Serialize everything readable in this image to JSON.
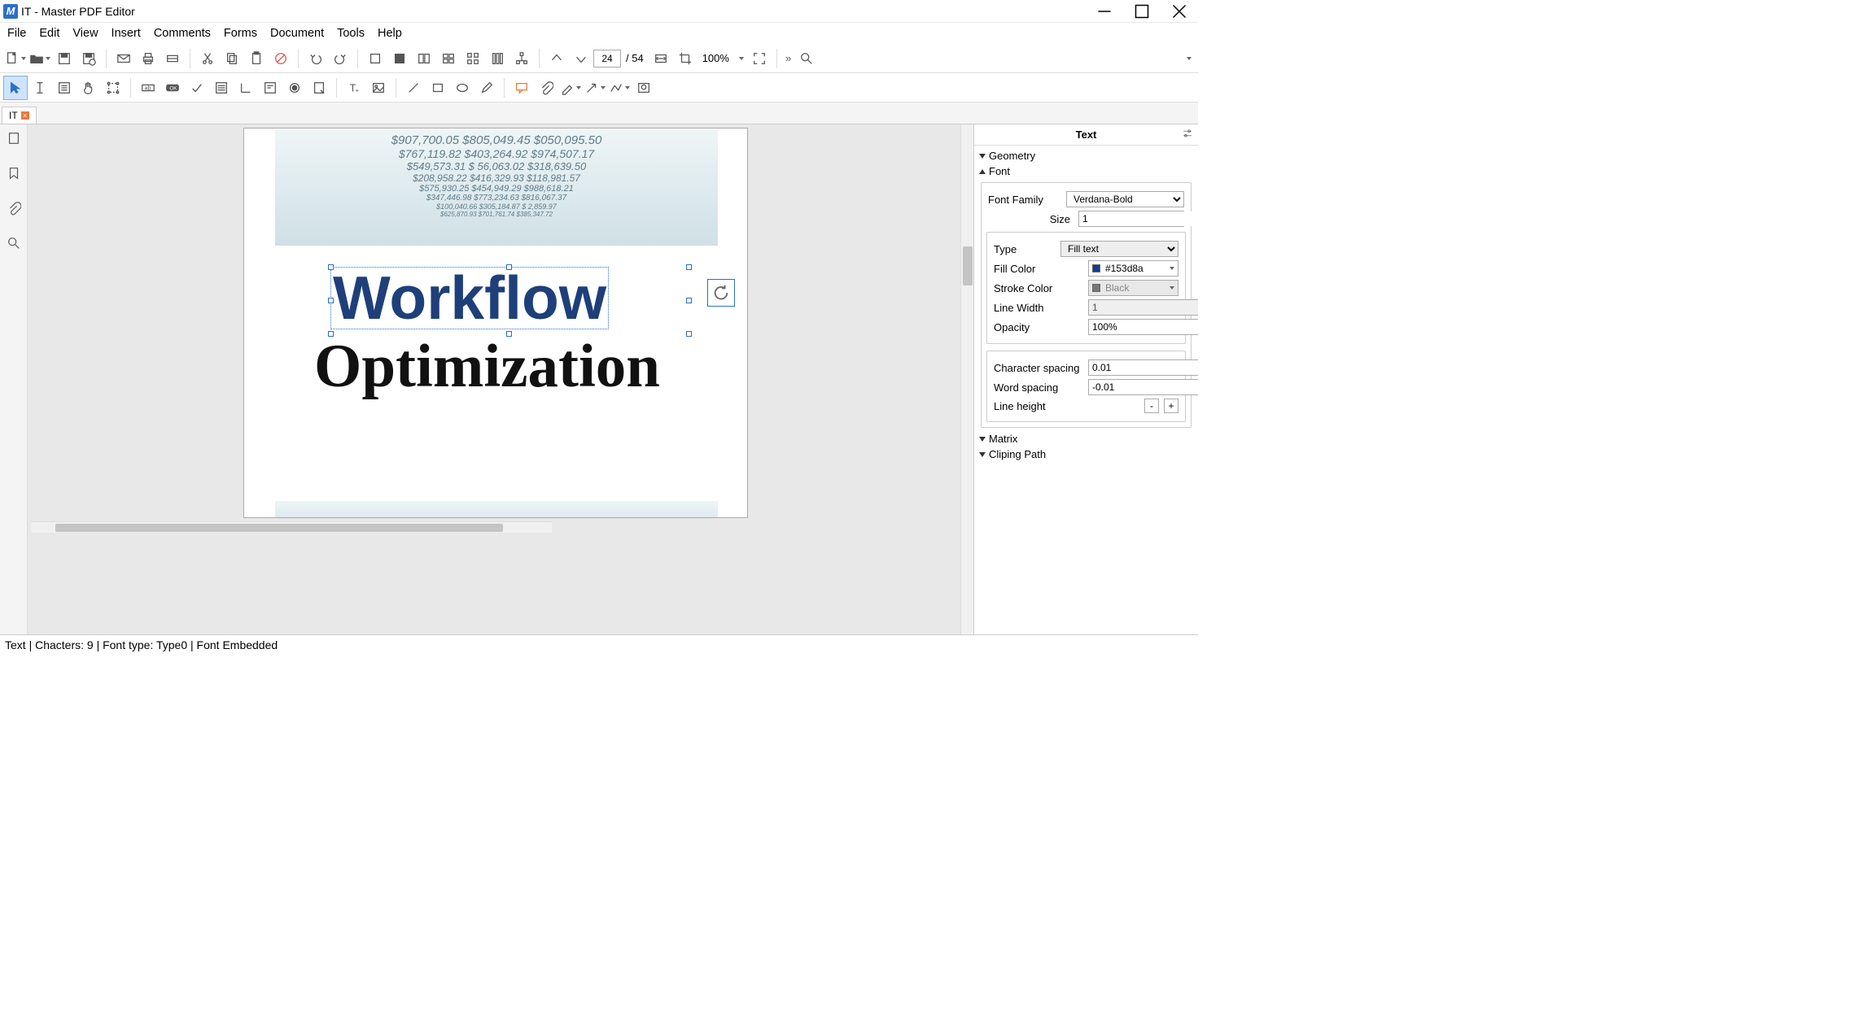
{
  "title": "IT - Master PDF Editor",
  "menu": [
    "File",
    "Edit",
    "View",
    "Insert",
    "Comments",
    "Forms",
    "Document",
    "Tools",
    "Help"
  ],
  "toolbar": {
    "page_current": "24",
    "page_sep": "/ 54",
    "zoom": "100%",
    "more": "»"
  },
  "tab": {
    "name": "IT"
  },
  "document": {
    "selected_text": "Workflow",
    "subtitle": "Optimization",
    "numbers": [
      "$907,700.05   $805,049.45   $050,095.50",
      "$767,119.82    $403,264.92    $974,507.17",
      "$549,573.31   $ 56,063.02   $318,639.50",
      "$208,958.22   $416,329.93   $118,981.57",
      "$575,930.25   $454,949.29   $988,618.21",
      "$347,446.98   $773,234.63   $816,067.37",
      "$100,040.66   $305,184.87   $  2,859.97",
      "$625,870.93   $701,761.74   $385,347.72"
    ]
  },
  "panel": {
    "title": "Text",
    "sections": {
      "geometry": "Geometry",
      "font": "Font",
      "matrix": "Matrix",
      "clip": "Cliping Path"
    },
    "font": {
      "family_label": "Font Family",
      "family": "Verdana-Bold",
      "size_label": "Size",
      "size": "1",
      "type_label": "Type",
      "type": "Fill text",
      "fill_label": "Fill Color",
      "fill_hex": "#153d8a",
      "stroke_label": "Stroke Color",
      "stroke": "Black",
      "lw_label": "Line Width",
      "lw": "1",
      "opacity_label": "Opacity",
      "opacity": "100%",
      "charsp_label": "Character spacing",
      "charsp": "0.01",
      "wordsp_label": "Word spacing",
      "wordsp": "-0.01",
      "lineh_label": "Line height"
    }
  },
  "status": "Text | Chacters: 9 | Font type: Type0 | Font Embedded"
}
